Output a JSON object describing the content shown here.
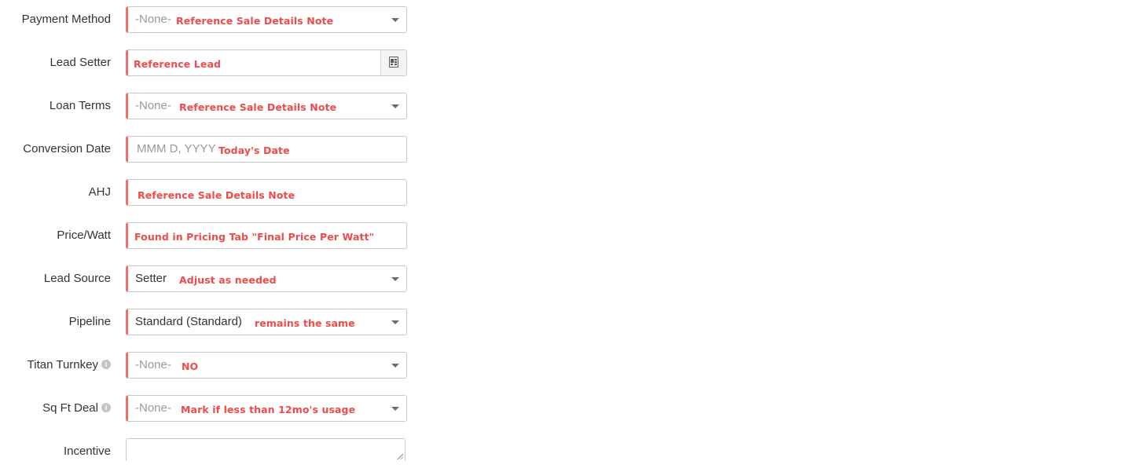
{
  "form": {
    "payment_method": {
      "label": "Payment Method",
      "value": "-None-",
      "note": "Reference Sale Details Note"
    },
    "lead_setter": {
      "label": "Lead Setter",
      "value": "",
      "note": "Reference Lead",
      "lookup_icon": "contact-card-icon"
    },
    "loan_terms": {
      "label": "Loan Terms",
      "value": "-None-",
      "note": "Reference Sale Details Note"
    },
    "conversion_date": {
      "label": "Conversion Date",
      "placeholder": "MMM D, YYYY",
      "note": "Today's Date"
    },
    "ahj": {
      "label": "AHJ",
      "value": "",
      "note": "Reference Sale Details Note"
    },
    "price_watt": {
      "label": "Price/Watt",
      "value": "",
      "note": "Found in Pricing Tab \"Final Price Per Watt\""
    },
    "lead_source": {
      "label": "Lead Source",
      "value": "Setter",
      "note": "Adjust as needed"
    },
    "pipeline": {
      "label": "Pipeline",
      "value": "Standard (Standard)",
      "note": "remains the same"
    },
    "titan_turnkey": {
      "label": "Titan Turnkey",
      "value": "-None-",
      "note": "NO",
      "info_icon": "i"
    },
    "sq_ft_deal": {
      "label": "Sq Ft Deal",
      "value": "-None-",
      "note": "Mark if less than 12mo's usage",
      "info_icon": "i"
    },
    "incentive": {
      "label": "Incentive",
      "value": ""
    }
  },
  "colors": {
    "required_accent": "#f07070",
    "note_text": "#f04a4a",
    "label_text": "#333333",
    "placeholder_text": "#9a9a9a",
    "border": "#c9c9c9"
  }
}
